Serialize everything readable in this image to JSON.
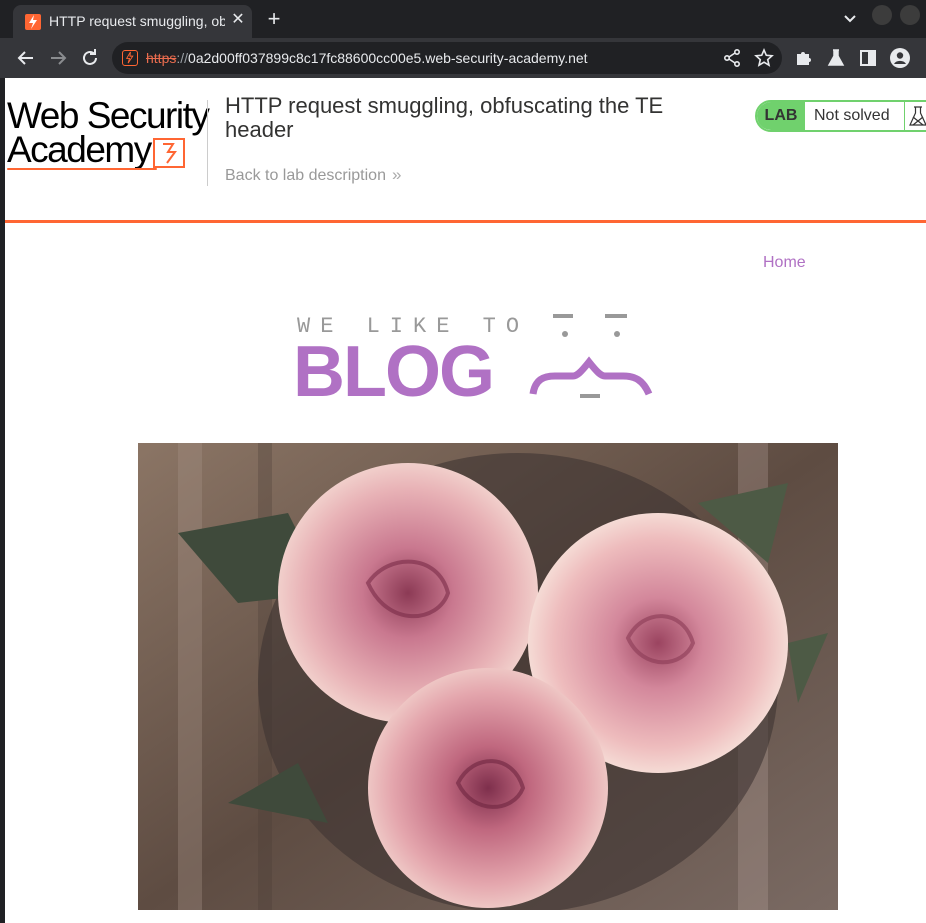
{
  "browser": {
    "tab": {
      "title": "HTTP request smuggling, obfuscating the TE header",
      "favicon": "portswigger-lightning-icon"
    },
    "url": {
      "scheme": "https",
      "separator": "://",
      "host": "0a2d00ff037899c8c17fc88600cc00e5.web-security-academy.net"
    }
  },
  "header": {
    "logo_line1": "Web Security",
    "logo_line2": "Academy",
    "lab_title": "HTTP request smuggling, obfuscating the TE header",
    "back_link": "Back to lab description",
    "back_chevron": "»",
    "lab_badge": "LAB",
    "lab_status": "Not solved"
  },
  "nav": {
    "home": "Home"
  },
  "blog_logo": {
    "tagline": "WE LIKE TO",
    "word": "BLOG"
  },
  "colors": {
    "accent": "#ff6633",
    "purple": "#b071c4",
    "lab_green": "#70d16d"
  }
}
